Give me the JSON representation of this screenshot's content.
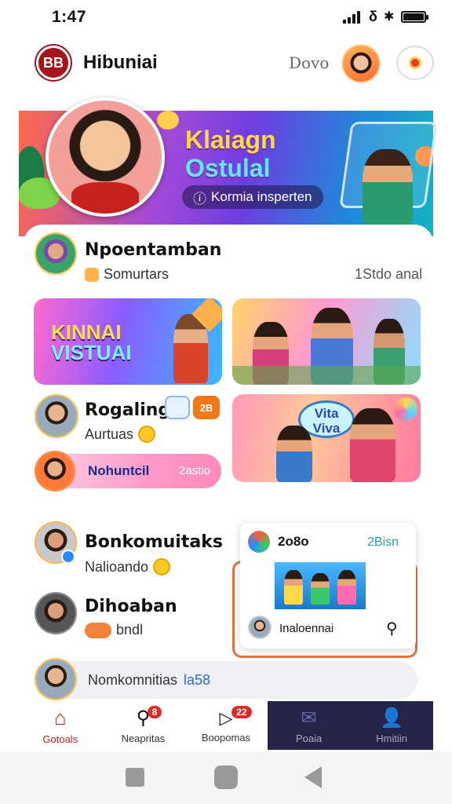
{
  "status": {
    "time": "1:47"
  },
  "header": {
    "logo_text": "BB",
    "title": "Hibuniai",
    "aux_text": "Dovo"
  },
  "hero": {
    "line1": "Klaiagn",
    "line2": "Ostulal",
    "pill": "Kormia insperten"
  },
  "profile": {
    "name": "Npoentamban",
    "sub": "Somurtars",
    "meta": "1Stdo anal"
  },
  "tiles": {
    "left_top_l1": "KINNAI",
    "left_top_l2": "VISTUAI",
    "right_mid_text": "Vita Viva"
  },
  "row1": {
    "name": "Rogaling",
    "sub": "Aurtuas",
    "badge": "2B"
  },
  "pill_row": {
    "label": "Nohuntcil",
    "meta": "2astio"
  },
  "row2": {
    "name": "Bonkomuitaks",
    "sub": "Nalioando"
  },
  "row3": {
    "name": "Dihoaban",
    "sub": "bndl"
  },
  "mini_card": {
    "title": "2o8o",
    "meta": "2Bisn",
    "caption": "Inaloennai"
  },
  "search_bar": {
    "text": "Nomkomnitias",
    "accent": "la58"
  },
  "nav": {
    "items": [
      {
        "label": "Gotoals",
        "badge": ""
      },
      {
        "label": "Neapritas",
        "badge": "8"
      },
      {
        "label": "Boopomas",
        "badge": "22"
      },
      {
        "label": "Poaia",
        "badge": ""
      },
      {
        "label": "Hmitiin",
        "badge": ""
      }
    ]
  },
  "colors": {
    "brand": "#a3141d",
    "nav_dark": "#24244a",
    "accent": "#e0743a"
  }
}
